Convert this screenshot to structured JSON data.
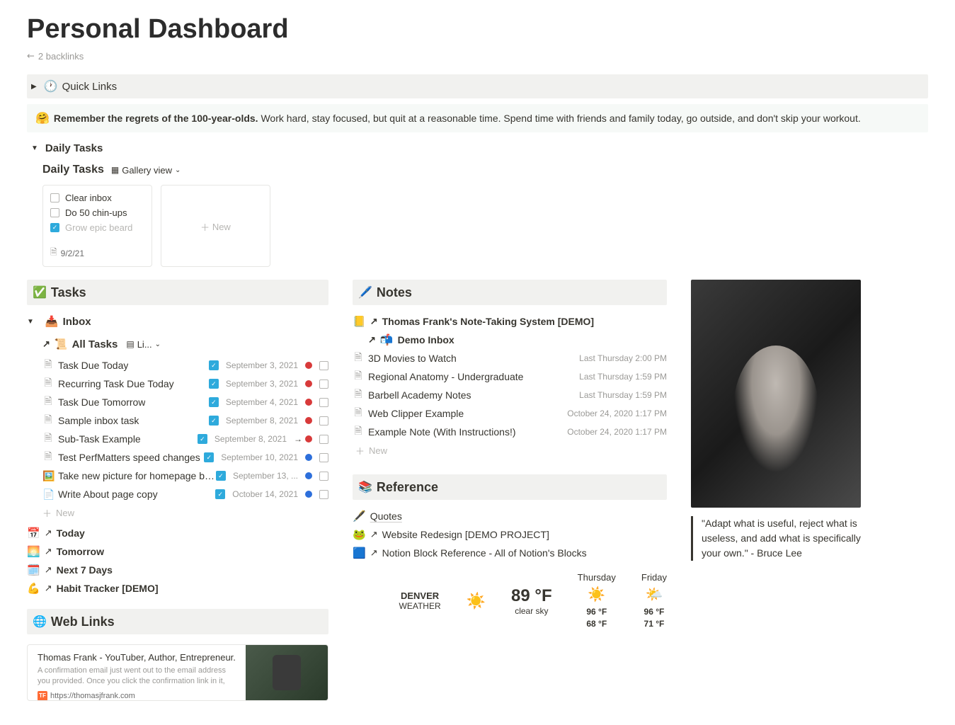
{
  "page": {
    "title": "Personal Dashboard",
    "backlinks": "2 backlinks"
  },
  "quick_links": {
    "label": "Quick Links"
  },
  "callout": {
    "bold": "Remember the regrets of the 100-year-olds.",
    "text": " Work hard, stay focused, but quit at a reasonable time. Spend time with friends and family today, go outside, and don't skip your workout."
  },
  "daily_tasks_toggle": "Daily Tasks",
  "daily_tasks": {
    "title": "Daily Tasks",
    "view": "Gallery view",
    "card": {
      "items": [
        {
          "text": "Clear inbox",
          "done": false
        },
        {
          "text": "Do 50 chin-ups",
          "done": false
        },
        {
          "text": "Grow epic beard",
          "done": true
        }
      ],
      "date": "9/2/21"
    },
    "new": "New"
  },
  "tasks": {
    "header": "Tasks",
    "inbox": "Inbox",
    "all_tasks": "All Tasks",
    "view_short": "Li...",
    "rows": [
      {
        "name": "Task Due Today",
        "date": "September 3, 2021",
        "dot": "red",
        "dash": false
      },
      {
        "name": "Recurring Task Due Today",
        "date": "September 3, 2021",
        "dot": "red",
        "dash": false
      },
      {
        "name": "Task Due Tomorrow",
        "date": "September 4, 2021",
        "dot": "red",
        "dash": false
      },
      {
        "name": "Sample inbox task",
        "date": "September 8, 2021",
        "dot": "red",
        "dash": false
      },
      {
        "name": "Sub-Task Example",
        "date": "September 8, 2021",
        "dot": "red",
        "dash": true
      },
      {
        "name": "Test PerfMatters speed changes",
        "date": "September 10, 2021",
        "dot": "blue",
        "dash": false
      },
      {
        "name": "Take new picture for homepage bac...",
        "date": "September 13, ...",
        "dot": "blue",
        "dash": false,
        "icon": "🖼️"
      },
      {
        "name": "Write About page copy",
        "date": "October 14, 2021",
        "dot": "blue",
        "dash": false,
        "icon": "📄"
      }
    ],
    "new": "New",
    "links": [
      {
        "emoji": "📅",
        "text": "Today"
      },
      {
        "emoji": "🌅",
        "text": "Tomorrow"
      },
      {
        "emoji": "🗓️",
        "text": "Next 7 Days"
      },
      {
        "emoji": "💪",
        "text": "Habit Tracker [DEMO]"
      }
    ]
  },
  "web_links": {
    "header": "Web Links",
    "card": {
      "title": "Thomas Frank - YouTuber, Author, Entrepreneur.",
      "desc": "A confirmation email just went out to the email address you provided. Once you click the confirmation link in it,",
      "url": "https://thomasjfrank.com"
    }
  },
  "notes": {
    "header": "Notes",
    "system": "Thomas Frank's Note-Taking System [DEMO]",
    "demo_inbox": "Demo Inbox",
    "rows": [
      {
        "name": "3D Movies to Watch",
        "date": "Last Thursday 2:00 PM"
      },
      {
        "name": "Regional Anatomy - Undergraduate",
        "date": "Last Thursday 1:59 PM"
      },
      {
        "name": "Barbell Academy Notes",
        "date": "Last Thursday 1:59 PM"
      },
      {
        "name": "Web Clipper Example",
        "date": "October 24, 2020 1:17 PM"
      },
      {
        "name": "Example Note (With Instructions!)",
        "date": "October 24, 2020 1:17 PM"
      }
    ],
    "new": "New"
  },
  "reference": {
    "header": "Reference",
    "links": [
      {
        "emoji": "🖋️",
        "text": "Quotes",
        "underline": true
      },
      {
        "emoji": "🐸",
        "text": "Website Redesign [DEMO PROJECT]"
      },
      {
        "emoji": "🟦",
        "text": "Notion Block Reference - All of Notion's Blocks"
      }
    ]
  },
  "quote": "\"Adapt what is useful, reject what is useless, and add what is specifically your own.\" - Bruce Lee",
  "weather": {
    "city": "DENVER",
    "city_sub": "WEATHER",
    "now_temp": "89 °F",
    "now_desc": "clear sky",
    "days": [
      {
        "day": "Thursday",
        "icon": "☀️",
        "hi": "96 °F",
        "lo": "68 °F"
      },
      {
        "day": "Friday",
        "icon": "🌤️",
        "hi": "96 °F",
        "lo": "71 °F"
      }
    ]
  }
}
